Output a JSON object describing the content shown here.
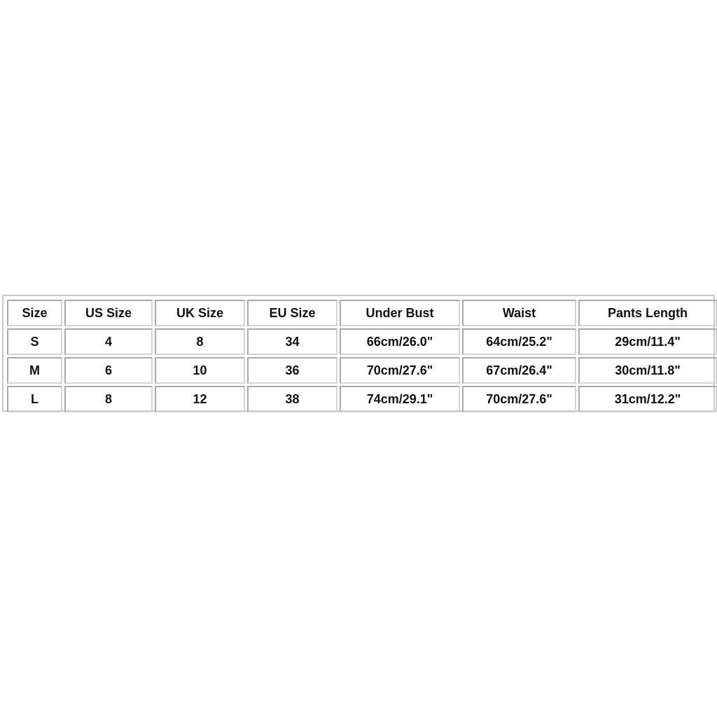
{
  "size_chart": {
    "headers": [
      "Size",
      "US Size",
      "UK Size",
      "EU Size",
      "Under Bust",
      "Waist",
      "Pants Length"
    ],
    "rows": [
      [
        "S",
        "4",
        "8",
        "34",
        "66cm/26.0\"",
        "64cm/25.2\"",
        "29cm/11.4\""
      ],
      [
        "M",
        "6",
        "10",
        "36",
        "70cm/27.6\"",
        "67cm/26.4\"",
        "30cm/11.8\""
      ],
      [
        "L",
        "8",
        "12",
        "38",
        "74cm/29.1\"",
        "70cm/27.6\"",
        "31cm/12.2\""
      ]
    ]
  }
}
